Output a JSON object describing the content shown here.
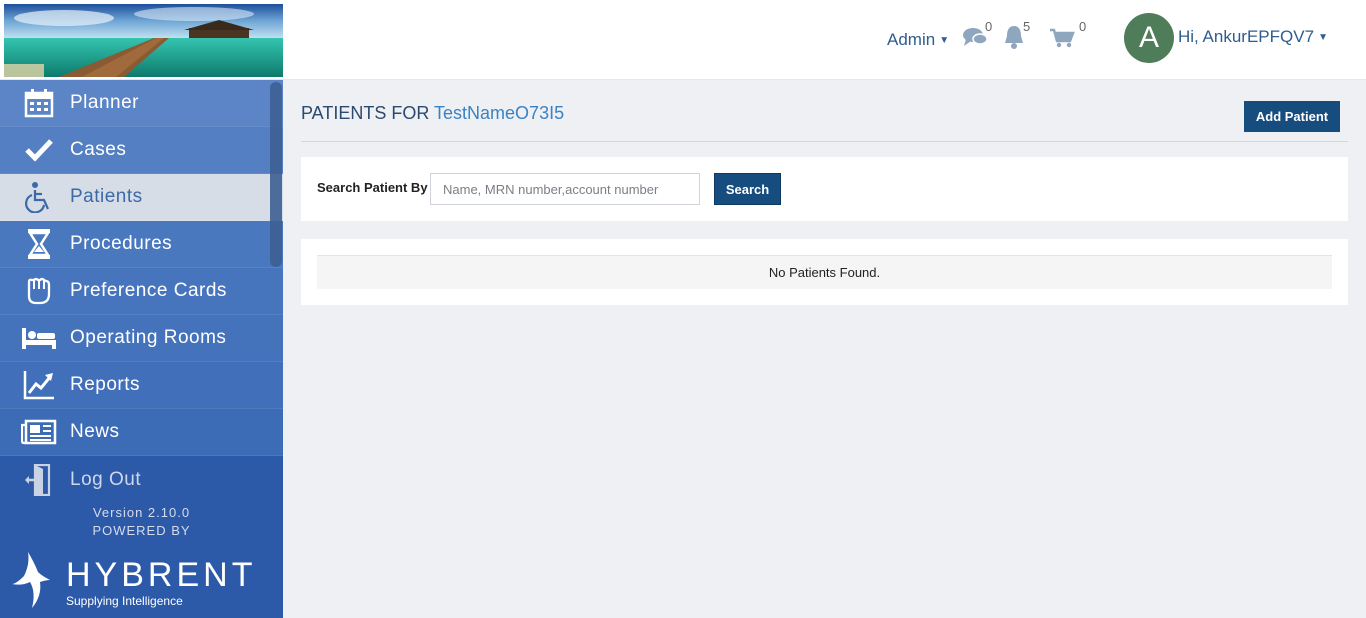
{
  "header": {
    "admin_label": "Admin",
    "messages_count": "0",
    "notifications_count": "5",
    "cart_count": "0",
    "avatar_initial": "A",
    "greeting": "Hi, AnkurEPFQV7"
  },
  "sidebar": {
    "items": [
      {
        "label": "Planner",
        "icon": "calendar-icon"
      },
      {
        "label": "Cases",
        "icon": "checkmark-icon"
      },
      {
        "label": "Patients",
        "icon": "wheelchair-icon",
        "active": true
      },
      {
        "label": "Procedures",
        "icon": "hourglass-icon"
      },
      {
        "label": "Preference Cards",
        "icon": "glove-icon"
      },
      {
        "label": "Operating Rooms",
        "icon": "bed-icon"
      },
      {
        "label": "Reports",
        "icon": "chart-line-icon"
      },
      {
        "label": "News",
        "icon": "newspaper-icon"
      },
      {
        "label": "Log Out",
        "icon": "door-exit-icon"
      }
    ],
    "version": "Version 2.10.0",
    "powered_by": "POWERED BY",
    "brand_name": "HYBRENT",
    "brand_tagline": "Supplying Intelligence"
  },
  "main": {
    "title_prefix": "PATIENTS FOR",
    "title_name": "TestNameO73I5",
    "add_patient_label": "Add Patient",
    "search_label": "Search Patient By",
    "search_placeholder": "Name, MRN number,account number",
    "search_value": "",
    "search_button_label": "Search",
    "empty_message": "No Patients Found."
  },
  "colors": {
    "sidebar_bg": "#2c5aa8",
    "active_item_bg": "#d6dde6",
    "primary_button": "#164c7e",
    "link_blue": "#3b82c4",
    "avatar_bg": "#4f7d5a"
  }
}
